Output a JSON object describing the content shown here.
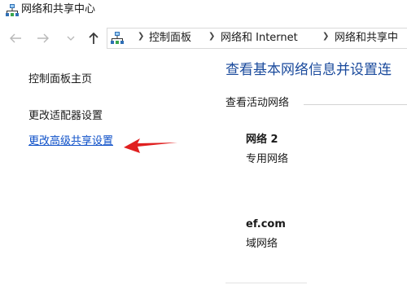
{
  "window": {
    "title": "网络和共享中心",
    "icon": "network-icon"
  },
  "navigation": {
    "back_icon": "arrow-left-icon",
    "forward_icon": "arrow-right-icon",
    "recent_icon": "chevron-down-icon",
    "up_icon": "arrow-up-icon"
  },
  "address_bar": {
    "icon": "network-icon",
    "breadcrumbs": [
      "控制面板",
      "网络和 Internet",
      "网络和共享中"
    ]
  },
  "sidebar": {
    "items": [
      {
        "label": "控制面板主页"
      },
      {
        "label": "更改适配器设置"
      },
      {
        "label": "更改高级共享设置"
      }
    ]
  },
  "main": {
    "title": "查看基本网络信息并设置连",
    "active_networks_header": "查看活动网络",
    "networks": [
      {
        "name": "网络  2",
        "type": "专用网络"
      },
      {
        "name": "ef.com",
        "type": "域网络"
      }
    ]
  },
  "colors": {
    "link": "#0e50c8",
    "title": "#1a4a9c",
    "annotation_arrow": "#e02020"
  }
}
